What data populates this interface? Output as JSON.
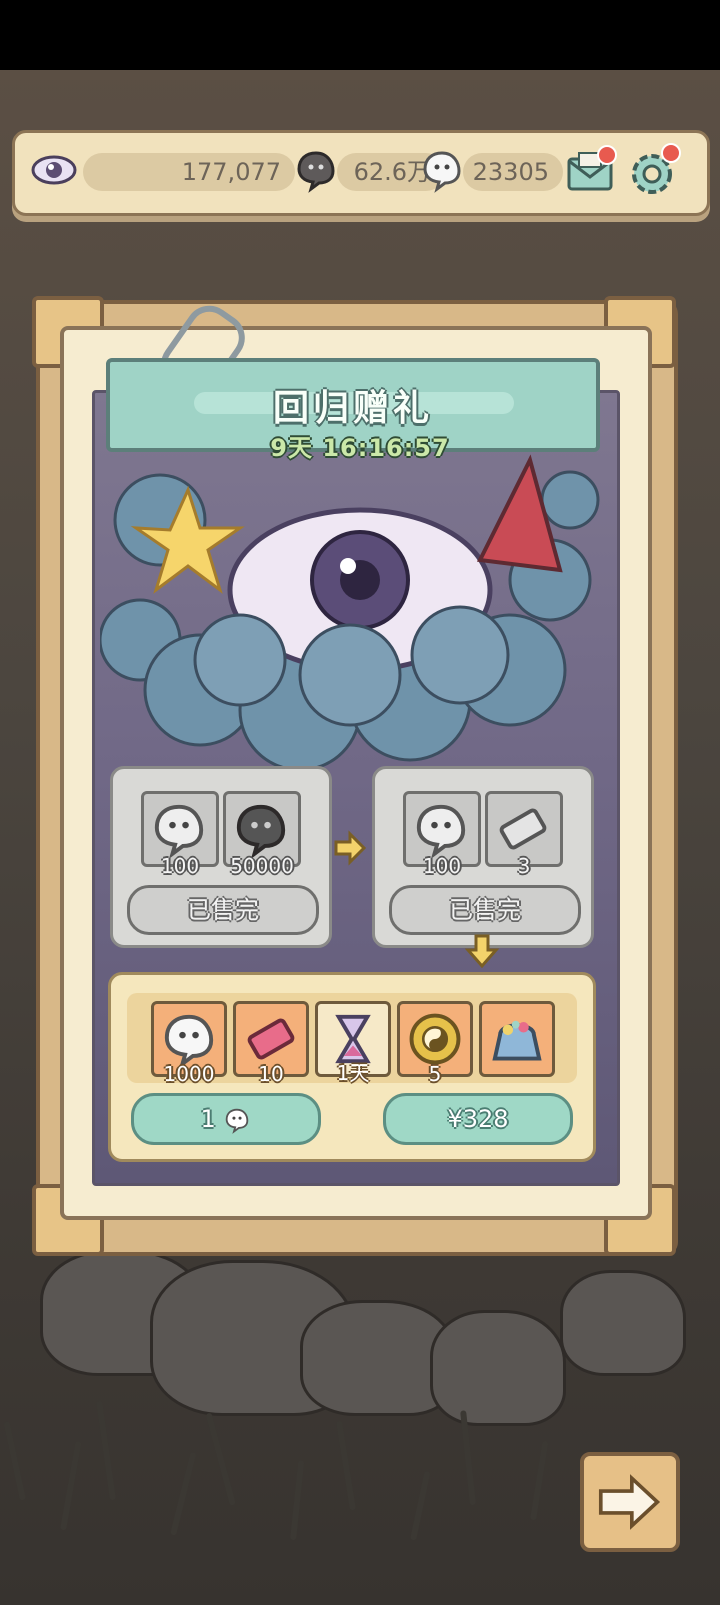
{
  "resources": {
    "eye_amount": "177,077",
    "dark_ghost_amount": "62.6万",
    "ghost_amount": "23305"
  },
  "event": {
    "title": "回归赠礼",
    "timer": "9天 16:16:57"
  },
  "offers": [
    {
      "items": [
        {
          "icon": "white-ghost-icon",
          "qty": "100"
        },
        {
          "icon": "dark-ghost-icon",
          "qty": "50000"
        }
      ],
      "status_label": "已售完"
    },
    {
      "items": [
        {
          "icon": "white-ghost-icon",
          "qty": "100"
        },
        {
          "icon": "ticket-icon",
          "qty": "3"
        }
      ],
      "status_label": "已售完"
    }
  ],
  "bundle": {
    "items": [
      {
        "icon": "white-ghost-icon",
        "qty": "1000"
      },
      {
        "icon": "pink-ticket-icon",
        "qty": "10"
      },
      {
        "icon": "hourglass-icon",
        "qty": "1天"
      },
      {
        "icon": "yin-yang-coin-icon",
        "qty": "5"
      },
      {
        "icon": "treasure-bag-icon",
        "qty": ""
      }
    ],
    "ghost_price": "1",
    "money_price": "¥328"
  },
  "colors": {
    "banner": "#9fd3c6",
    "panel": "#d8b888",
    "accent_button": "#9fd8c6",
    "notification": "#e85a4f"
  }
}
